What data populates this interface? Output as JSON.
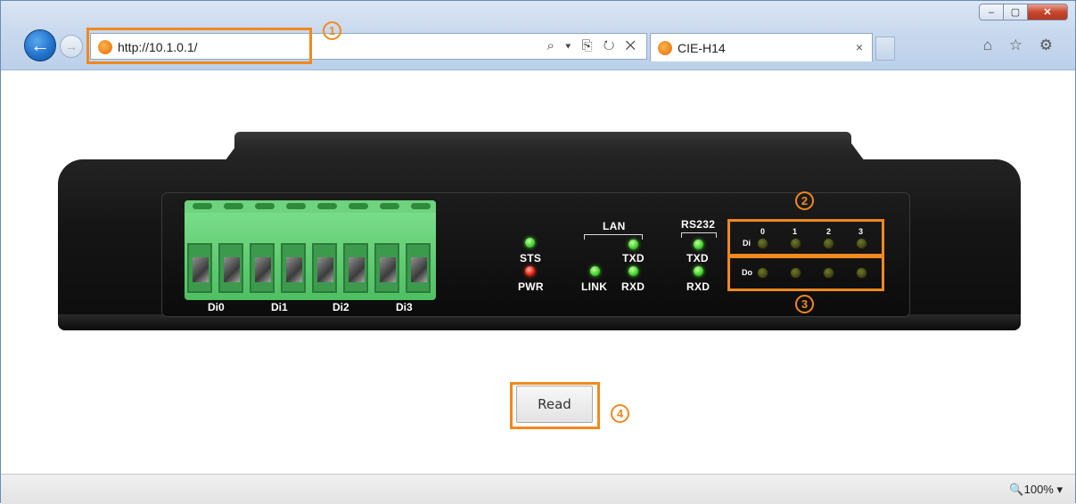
{
  "browser": {
    "url": "http://10.1.0.1/",
    "tab_title": "CIE-H14",
    "tab_close": "×",
    "address_tools": "⌕ ▾ ⎘ ↻ ✕",
    "right_icons": "⌂ ☆ ⚙",
    "window_buttons": {
      "minimize": "–",
      "maximize": "▢",
      "close": "✕"
    },
    "back": "←",
    "forward": "→"
  },
  "device": {
    "terminal_labels": [
      "Di0",
      "Di1",
      "Di2",
      "Di3"
    ],
    "status": {
      "sts": "STS",
      "pwr": "PWR"
    },
    "lan": {
      "group": "LAN",
      "txd": "TXD",
      "link": "LINK",
      "rxd": "RXD"
    },
    "rs232": {
      "group": "RS232",
      "txd": "TXD",
      "rxd": "RXD"
    },
    "di": {
      "label": "Di",
      "indices": [
        "0",
        "1",
        "2",
        "3"
      ]
    },
    "do": {
      "label": "Do"
    }
  },
  "callouts": {
    "one": "1",
    "two": "2",
    "three": "3",
    "four": "4"
  },
  "read_button": "Read",
  "statusbar": {
    "zoom": "🔍100%  ▾"
  },
  "colors": {
    "callout": "#f0891f",
    "led_green": "#3ccf2a",
    "led_red": "#e81d0f",
    "terminal": "#5ccb6e"
  }
}
